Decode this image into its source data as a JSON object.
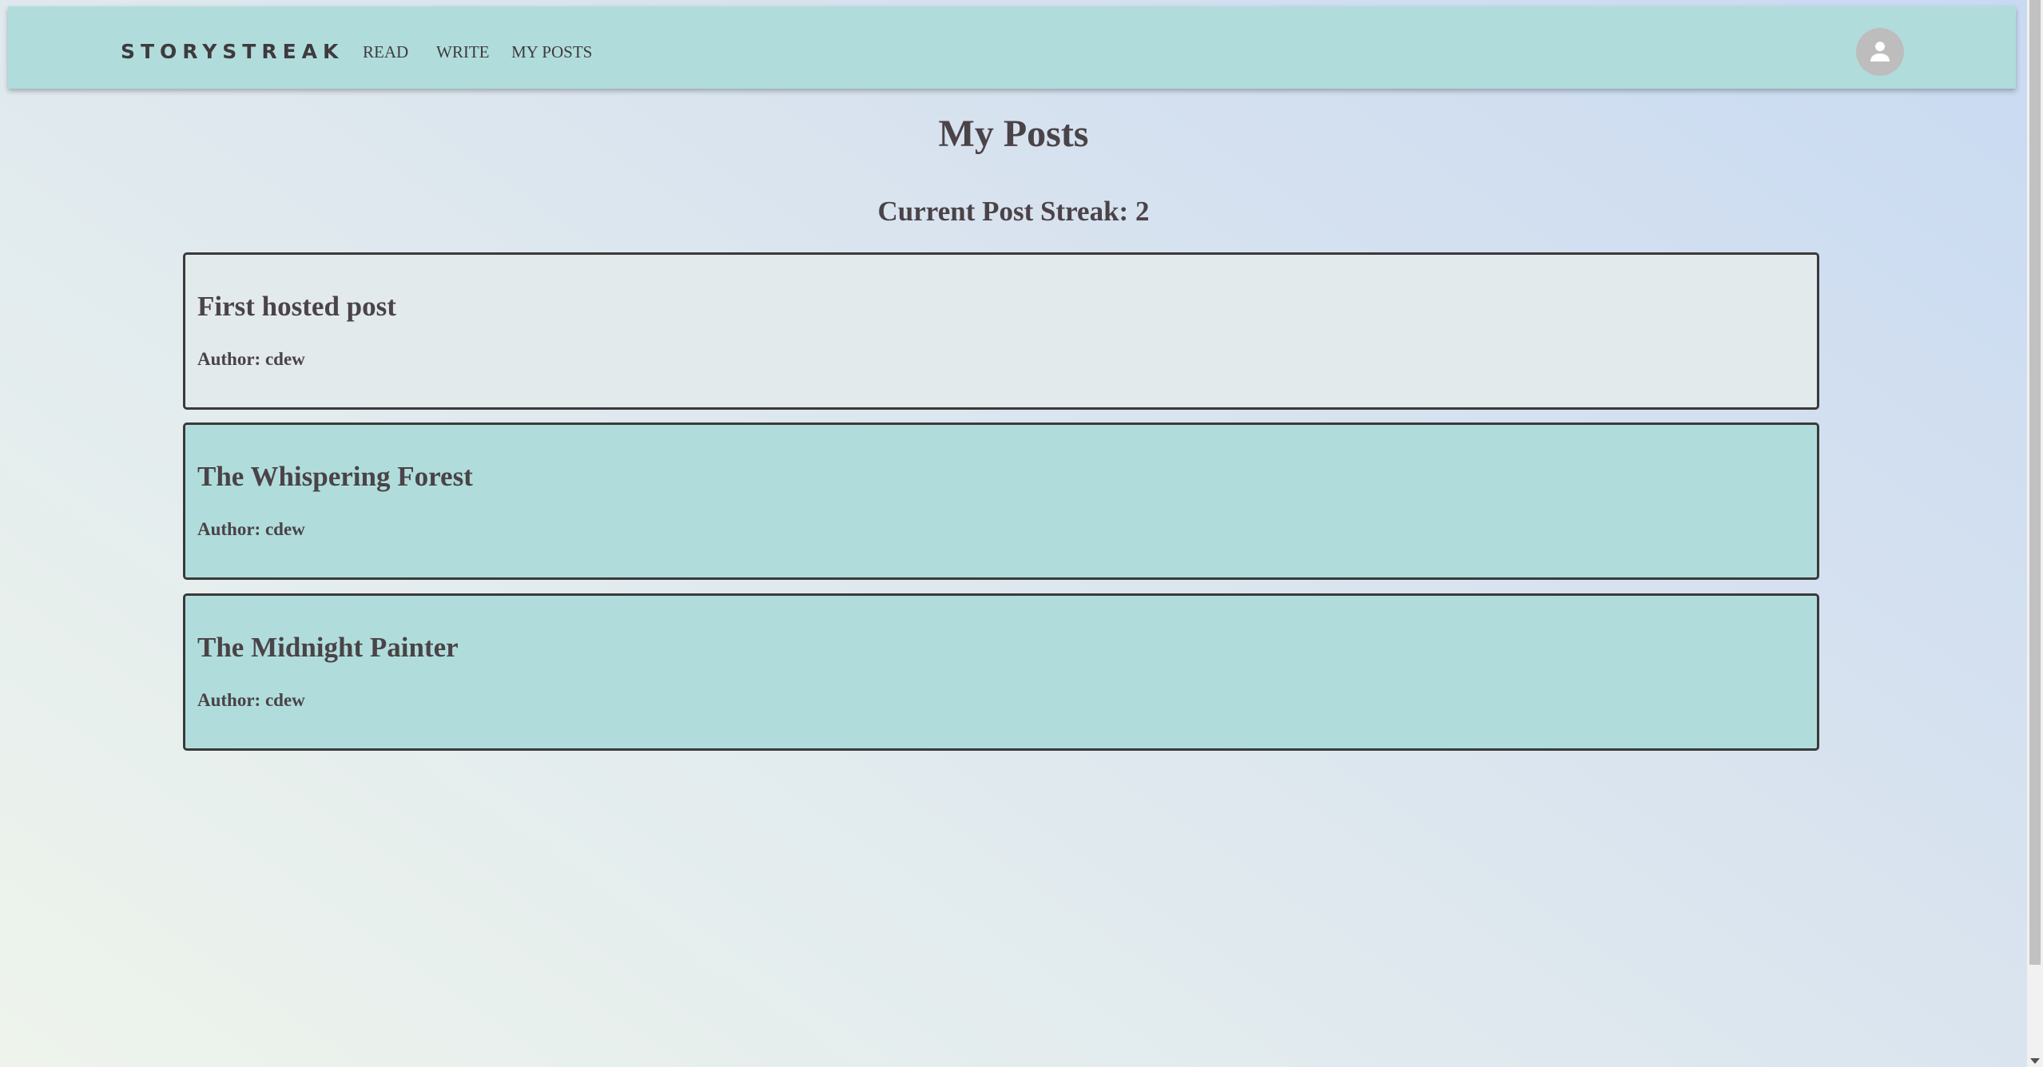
{
  "nav": {
    "brand": "STORYSTREAK",
    "links": [
      "READ",
      "WRITE",
      "MY POSTS"
    ]
  },
  "page": {
    "title": "My Posts",
    "streak": "Current Post Streak: 2"
  },
  "posts": [
    {
      "title": "First hosted post",
      "author": "Author: cdew"
    },
    {
      "title": "The Whispering Forest",
      "author": "Author: cdew"
    },
    {
      "title": "The Midnight Painter",
      "author": "Author: cdew"
    }
  ],
  "icons": {
    "avatar": "account-circle-icon"
  },
  "colors": {
    "navbar": "#b0dddc",
    "card": "#b0dddc",
    "card_first": "#e2eaeb",
    "text": "#4a4347"
  }
}
